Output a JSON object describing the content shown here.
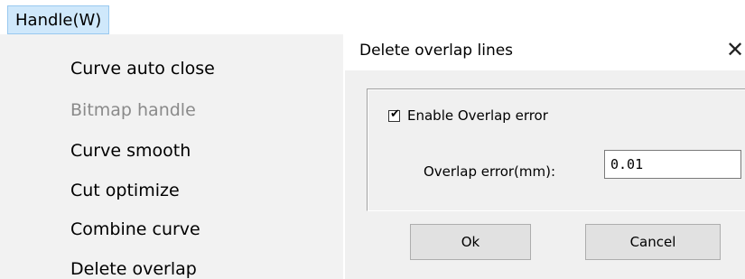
{
  "menu": {
    "title": "Handle(W)",
    "items": [
      {
        "label": "Curve auto close",
        "enabled": true
      },
      {
        "label": "Bitmap handle",
        "enabled": false
      },
      {
        "label": "Curve smooth",
        "enabled": true
      },
      {
        "label": "Cut optimize",
        "enabled": true
      },
      {
        "label": "Combine curve",
        "enabled": true
      },
      {
        "label": "Delete overlap",
        "enabled": true
      }
    ]
  },
  "dialog": {
    "title": "Delete overlap lines",
    "close_glyph": "✕",
    "checkbox": {
      "label": "Enable Overlap error",
      "checked": true,
      "mark": "✔"
    },
    "overlap_error": {
      "label": "Overlap error(mm):",
      "value": "0.01"
    },
    "ok_label": "Ok",
    "cancel_label": "Cancel"
  }
}
